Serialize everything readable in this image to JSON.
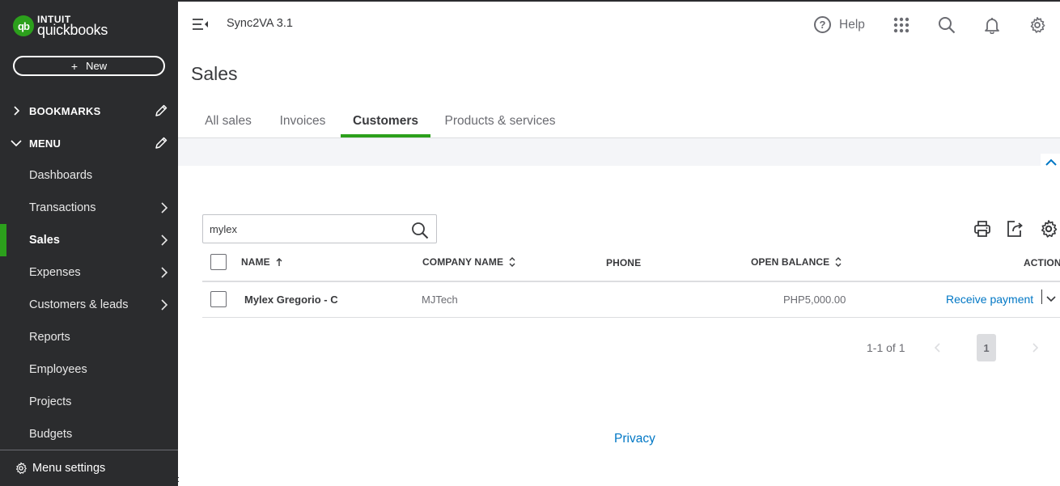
{
  "brand": {
    "intuit": "INTUIT",
    "product": "quickbooks",
    "mark": "qb",
    "accent_color": "#2ca01c",
    "sidebar_color": "#2b2c2e"
  },
  "sidebar": {
    "new_button": {
      "plus": "+",
      "label": "New"
    },
    "bookmarks": {
      "label": "BOOKMARKS",
      "icon": "chevron-right-icon",
      "edit_icon": "pencil-icon"
    },
    "menu": {
      "label": "MENU",
      "icon": "chevron-down-icon",
      "edit_icon": "pencil-icon"
    },
    "items": [
      {
        "label": "Dashboards",
        "has_arrow": false,
        "active": false
      },
      {
        "label": "Transactions",
        "has_arrow": true,
        "active": false
      },
      {
        "label": "Sales",
        "has_arrow": true,
        "active": true
      },
      {
        "label": "Expenses",
        "has_arrow": true,
        "active": false
      },
      {
        "label": "Customers & leads",
        "has_arrow": true,
        "active": false
      },
      {
        "label": "Reports",
        "has_arrow": false,
        "active": false
      },
      {
        "label": "Employees",
        "has_arrow": false,
        "active": false
      },
      {
        "label": "Projects",
        "has_arrow": false,
        "active": false
      },
      {
        "label": "Budgets",
        "has_arrow": false,
        "active": false
      }
    ],
    "menu_settings": {
      "label": "Menu settings",
      "icon": "gear-icon"
    }
  },
  "topbar": {
    "company_name": "Sync2VA 3.1",
    "help_label": "Help",
    "help_glyph": "?",
    "icons": [
      "apps-grid-icon",
      "search-icon",
      "bell-icon",
      "gear-icon"
    ]
  },
  "page": {
    "title": "Sales",
    "tabs": [
      {
        "label": "All sales",
        "active": false
      },
      {
        "label": "Invoices",
        "active": false
      },
      {
        "label": "Customers",
        "active": true
      },
      {
        "label": "Products & services",
        "active": false
      }
    ]
  },
  "customers": {
    "search": {
      "value": "mylex"
    },
    "toolbar_icons": [
      "printer-icon",
      "export-icon",
      "gear-icon"
    ],
    "columns": {
      "name": "NAME",
      "company": "COMPANY NAME",
      "phone": "PHONE",
      "open_balance": "OPEN BALANCE",
      "action": "ACTION"
    },
    "rows": [
      {
        "name": "Mylex Gregorio - C",
        "company": "MJTech",
        "phone": "",
        "open_balance": "PHP5,000.00",
        "action": "Receive payment"
      }
    ],
    "pagination": {
      "summary": "1-1 of 1",
      "current_page": "1"
    }
  },
  "footer": {
    "privacy": "Privacy",
    "stray": ":"
  },
  "colors": {
    "link": "#0077c5",
    "text": "#393a3d",
    "muted": "#6b6c72",
    "border": "#dcdde0"
  }
}
